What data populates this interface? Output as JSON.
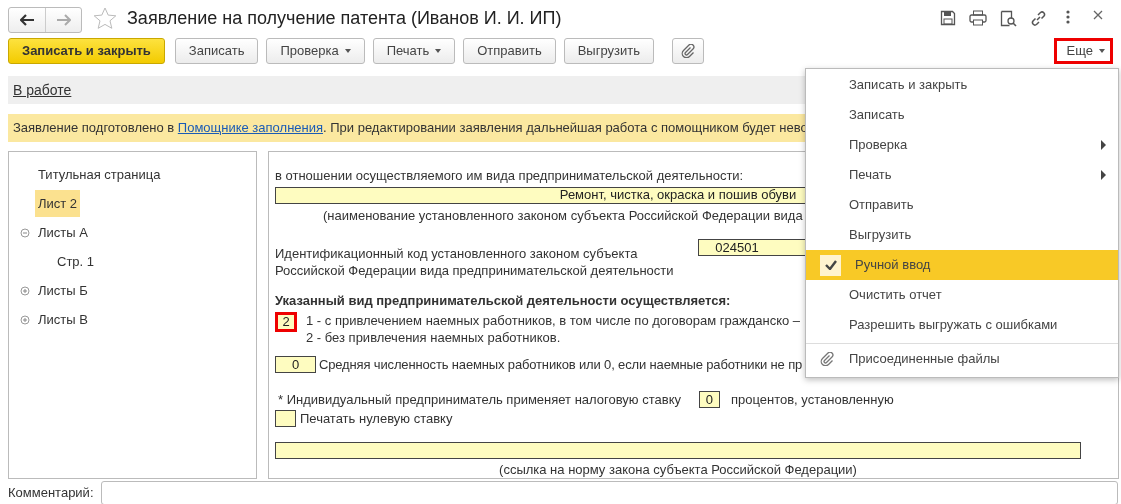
{
  "window": {
    "title": "Заявление на получение патента (Иванов И. И. ИП)"
  },
  "title_actions": [
    {
      "kind": "save"
    },
    {
      "kind": "print"
    },
    {
      "kind": "preview"
    },
    {
      "kind": "link"
    },
    {
      "kind": "more"
    },
    {
      "kind": "close"
    }
  ],
  "toolbar": [
    {
      "kind": "primary",
      "label": "Записать и закрыть"
    },
    {
      "kind": "plain",
      "label": "Записать"
    },
    {
      "kind": "dropdown",
      "label": "Проверка"
    },
    {
      "kind": "dropdown",
      "label": "Печать"
    },
    {
      "kind": "plain",
      "label": "Отправить"
    },
    {
      "kind": "plain",
      "label": "Выгрузить"
    },
    {
      "kind": "attach"
    }
  ],
  "more_button": {
    "label": "Еще",
    "outlined": true
  },
  "status_link": "В работе",
  "info_bar": {
    "before": "Заявление подготовлено в ",
    "link": "Помощнике заполнения",
    "after": ". При редактировании заявления дальнейшая работа с помощником будет нево"
  },
  "tree": [
    {
      "label": "Титульная страница",
      "selected": false
    },
    {
      "label": "Лист 2",
      "selected": true
    },
    {
      "label": "Листы А",
      "selected": false,
      "expanded": true,
      "children": [
        {
          "label": "Стр. 1",
          "selected": false
        }
      ]
    },
    {
      "label": "Листы Б",
      "selected": false,
      "expanded": false
    },
    {
      "label": "Листы В",
      "selected": false,
      "expanded": false
    }
  ],
  "form": {
    "activity_label": "в отношении осуществляемого им вида предпринимательской деятельности:",
    "activity_value": "Ремонт, чистка, окраска и пошив обуви",
    "activity_caption": "(наименование установленного законом субъекта Российской Федерации вида",
    "code_label": [
      "Идентификационный код установленного законом субъекта",
      "Российской Федерации вида предпринимательской деятельности"
    ],
    "code_value": "024501",
    "mode_heading": "Указанный вид предпринимательской деятельности осуществляется:",
    "mode_value": "2",
    "mode_outlined": true,
    "mode_options": [
      "1 - с привлечением наемных работников, в том числе по договорам гражданско –",
      "2 - без привлечения наемных работников."
    ],
    "employees_value": "0",
    "employees_label": "Средняя численность наемных работников или 0, если наемные работники не пр",
    "rate_prefix": "* Индивидуальный предприниматель применяет налоговую ставку",
    "rate_value": "0",
    "rate_suffix": "процентов, установленную",
    "zero_rate_label": "Печатать нулевую ставку",
    "zero_rate_checked": false,
    "law_caption": "(ссылка на норму закона субъекта Российской Федерации)"
  },
  "comment": {
    "label": "Комментарий:"
  },
  "menu": [
    {
      "kind": "command",
      "label": "Записать и закрыть",
      "selected": false
    },
    {
      "kind": "command",
      "label": "Записать",
      "selected": false
    },
    {
      "kind": "submenu",
      "label": "Проверка",
      "selected": false
    },
    {
      "kind": "submenu",
      "label": "Печать",
      "selected": false
    },
    {
      "kind": "command",
      "label": "Отправить",
      "selected": false
    },
    {
      "kind": "command",
      "label": "Выгрузить",
      "selected": false
    },
    {
      "kind": "toggle",
      "label": "Ручной ввод",
      "checked": true,
      "selected": true
    },
    {
      "kind": "command",
      "label": "Очистить отчет",
      "selected": false
    },
    {
      "kind": "command",
      "label": "Разрешить выгружать с ошибками",
      "selected": false
    },
    {
      "kind": "attachment",
      "label": "Присоединенные файлы",
      "selected": false
    }
  ]
}
